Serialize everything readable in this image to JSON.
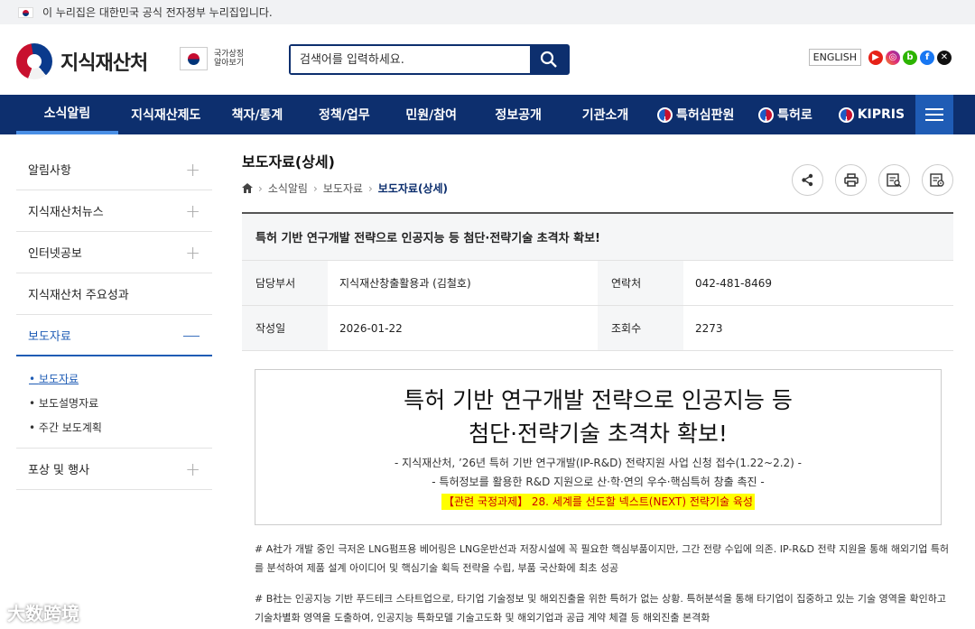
{
  "gov_banner": "이 누리집은 대한민국 공식 전자정부 누리집입니다.",
  "header": {
    "logo_text": "지식재산처",
    "symbol_line1": "국가상징",
    "symbol_line2": "알아보기",
    "search_placeholder": "검색어를 입력하세요.",
    "english": "ENGLISH"
  },
  "nav": {
    "items": [
      "소식알림",
      "지식재산제도",
      "책자/통계",
      "정책/업무",
      "민원/참여",
      "정보공개",
      "기관소개",
      "특허심판원",
      "특허로",
      "KIPRIS"
    ]
  },
  "sidebar": {
    "items": [
      "알림사항",
      "지식재산처뉴스",
      "인터넷공보",
      "지식재산처 주요성과",
      "보도자료",
      "포상 및 행사"
    ],
    "sub_items": [
      "보도자료",
      "보도설명자료",
      "주간 보도계획"
    ]
  },
  "page": {
    "title": "보도자료(상세)",
    "breadcrumb": [
      "소식알림",
      "보도자료",
      "보도자료(상세)"
    ]
  },
  "article": {
    "title": "특허 기반 연구개발 전략으로 인공지능 등 첨단·전략기술 초격차 확보!",
    "dept_label": "담당부서",
    "dept": "지식재산창출활용과 (김철호)",
    "contact_label": "연락처",
    "contact": "042-481-8469",
    "date_label": "작성일",
    "date": "2026-01-22",
    "views_label": "조회수",
    "views": "2273",
    "headline1": "특허 기반 연구개발 전략으로 인공지능 등",
    "headline2": "첨단·전략기술 초격차 확보!",
    "sub1": "- 지식재산처, ’26년 특허 기반 연구개발(IP-R&D) 전략지원 사업 신청 접수(1.22~2.2) -",
    "sub2": "- 특허정보를 활용한 R&D 지원으로 산·학·연의 우수·핵심특허 창출 촉진 -",
    "highlight": "【관련 국정과제】 28. 세계를 선도할 넥스트(NEXT) 전략기술 육성",
    "para1": "# A社가 개발 중인 극저온 LNG펌프용 베어링은 LNG운반선과 저장시설에 꼭 필요한 핵심부품이지만, 그간 전량 수입에 의존. IP-R&D 전략 지원을 통해 해외기업 특허를 분석하여 제품 설계 아이디어 및 핵심기술 획득 전략을 수립, 부품 국산화에 최초 성공",
    "para2": "# B社는 인공지능 기반 푸드테크 스타트업으로, 타기업 기술정보 및 해외진출을 위한 특허가 없는 상황. 특허분석을 통해 타기업이 집중하고 있는 기술 영역을 확인하고 기술차별화 영역을 도출하여, 인공지능 특화모델 기술고도화 및 해외기업과 공급 계약 체결 등 해외진출 본격화"
  },
  "watermark": "大数跨境"
}
